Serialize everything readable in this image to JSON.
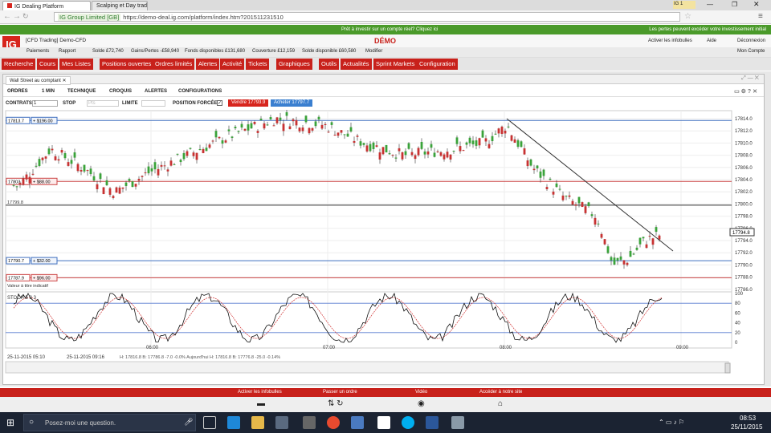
{
  "browser": {
    "tabs": [
      {
        "label": "IG Dealing Platform"
      },
      {
        "label": "Scalping et Day trad"
      }
    ],
    "url": "https://demo-deal.ig.com/platform/index.htm?201511231510",
    "site_badge": "IG Group Limited [GB]",
    "profile_label": "IG 1"
  },
  "promo": {
    "left": "Prêt à investir sur un compte réel? Cliquez ici",
    "right": "Les pertes peuvent excéder votre investissement initial"
  },
  "header": {
    "account": "[CFD Trading] Demo-CFD",
    "mode": "DÉMO",
    "links": [
      "Paiements",
      "Rapport"
    ],
    "balances": {
      "solde": "Solde £72,740",
      "gp": "Gains/Pertes -£58,940",
      "fonds": "Fonds disponibles £131,680",
      "couverture": "Couverture £12,159",
      "solde_dispo": "Solde disponible £60,580",
      "modifier": "Modifier"
    },
    "right_links": {
      "infobulles": "Activer les infobulles",
      "aide": "Aide",
      "deconnexion": "Déconnexion",
      "compte": "Mon Compte"
    }
  },
  "menu": [
    "Recherche",
    "Cours",
    "Mes Listes",
    "Positions ouvertes",
    "Ordres limités",
    "Alertes",
    "Activité",
    "Tickets",
    "Graphiques",
    "Outils",
    "Actualités",
    "Sprint Markets",
    "Configuration"
  ],
  "chart_window": {
    "tab": "Wall Street au comptant",
    "toolbar": [
      "ORDRES",
      "1 MIN",
      "TECHNIQUE",
      "CROQUIS",
      "ALERTES",
      "CONFIGURATIONS"
    ],
    "contracts_label": "CONTRATS",
    "contracts_value": "1",
    "stop_label": "STOP",
    "stop_placeholder": "Pts",
    "limit_label": "LIMITE",
    "forced_label": "POSITION FORCÉE",
    "sell": "Vendre 17793.9",
    "buy": "Acheter 17797.7",
    "indicator_label": "Valeur à titre indicatif",
    "stoch_label": "STOCH 5 3 3",
    "price_tag": "17794.8",
    "levels": [
      {
        "price": "17813.7",
        "pnl": "+ $196.00",
        "tagcolor": "#3f6fbf"
      },
      {
        "price": "17803.7",
        "pnl": "+ $88.00",
        "tagcolor": "#cc4444"
      },
      {
        "price": "17799.8",
        "pnl": ""
      },
      {
        "price": "17790.7",
        "pnl": "+ $32.00",
        "tagcolor": "#3f6fbf"
      },
      {
        "price": "17787.9",
        "pnl": "+ $96.00",
        "tagcolor": "#cc4444"
      }
    ],
    "yticks": [
      "17814.0",
      "17812.0",
      "17810.0",
      "17808.0",
      "17806.0",
      "17804.0",
      "17802.0",
      "17800.0",
      "17798.0",
      "17796.0",
      "17794.0",
      "17792.0",
      "17790.0",
      "17788.0",
      "17786.0"
    ],
    "stoch_ticks": [
      "100",
      "80",
      "60",
      "40",
      "20",
      "0"
    ],
    "xticks": [
      "06:00",
      "07:00",
      "08:00",
      "09:00"
    ],
    "date_from": "25-11-2015 05:10",
    "date_to": "25-11-2015 09:16",
    "ohlc": "H: 17816.8 B: 17786.8 -7.0 -0.0% Aujourd'hui H: 17816.8 B: 17776.8 -25.0 -0.14%"
  },
  "footer": [
    "Activer les infobulles",
    "Passer un ordre",
    "Vidéo",
    "Accéder à notre site"
  ],
  "taskbar": {
    "search": "Posez-moi une question.",
    "time": "08:53",
    "date": "25/11/2015"
  }
}
